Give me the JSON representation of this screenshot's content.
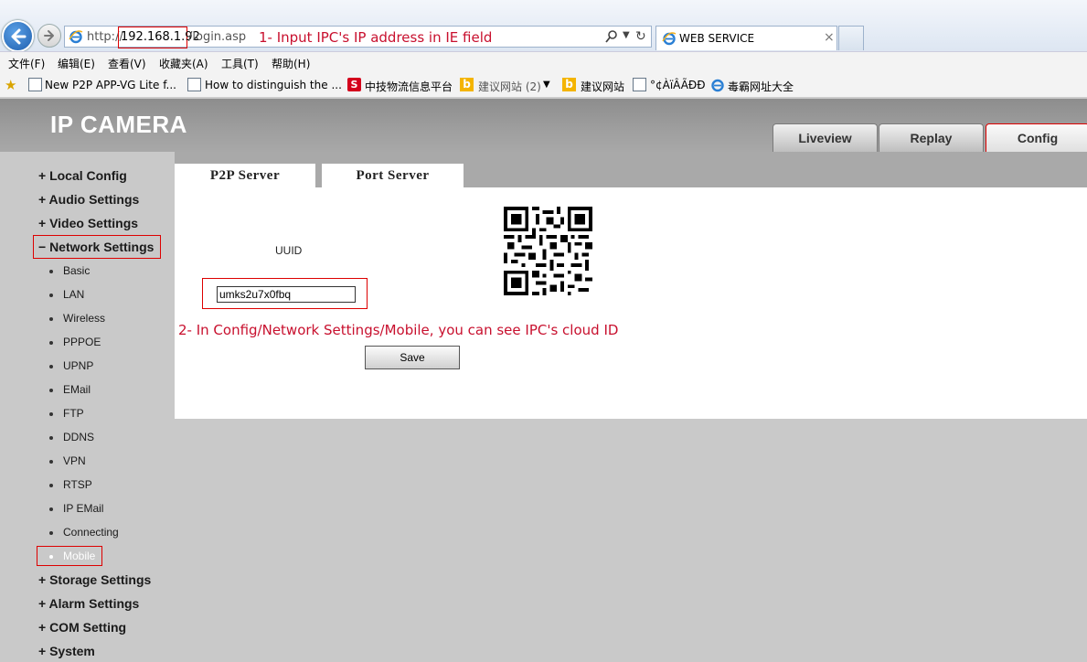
{
  "browser": {
    "address_prefix": "http://",
    "address_ip": "192.168.1.92",
    "address_path": "/login.asp",
    "tab_title": "WEB SERVICE",
    "tab_close": "×",
    "menu": [
      "文件(F)",
      "编辑(E)",
      "查看(V)",
      "收藏夹(A)",
      "工具(T)",
      "帮助(H)"
    ],
    "favorites": [
      {
        "label": "New P2P APP-VG Lite f...",
        "icon": "page-icon"
      },
      {
        "label": "How to distinguish the ...",
        "icon": "page-icon"
      },
      {
        "label": "中技物流信息平台",
        "icon": "s-logo-icon"
      },
      {
        "label": "建议网站 (2)",
        "icon": "bing-icon"
      },
      {
        "label": "建议网站",
        "icon": "bing-icon"
      },
      {
        "label": "°¢ÀïÂÃÐÐ",
        "icon": "page-icon"
      },
      {
        "label": "毒霸网址大全",
        "icon": "ie-icon"
      }
    ]
  },
  "annotations": {
    "step1": "1- Input IPC's IP address in IE field",
    "step2": "2- In Config/Network Settings/Mobile, you can see IPC's cloud ID"
  },
  "camera": {
    "title": "IP CAMERA",
    "nav": {
      "liveview": "Liveview",
      "replay": "Replay",
      "config": "Config"
    }
  },
  "sidebar": {
    "groups": {
      "local": "+ Local Config",
      "audio": "+ Audio Settings",
      "video": "+ Video Settings",
      "network": "− Network Settings",
      "storage": "+ Storage Settings",
      "alarm": "+ Alarm Settings",
      "com": "+ COM Setting",
      "system": "+ System"
    },
    "network_items": [
      "Basic",
      "LAN",
      "Wireless",
      "PPPOE",
      "UPNP",
      "EMail",
      "FTP",
      "DDNS",
      "VPN",
      "RTSP",
      "IP EMail",
      "Connecting",
      "Mobile"
    ]
  },
  "content": {
    "tabs": {
      "p2p": "P2P Server",
      "port": "Port Server"
    },
    "uuid_label": "UUID",
    "uuid_value": "umks2u7x0fbq",
    "save_label": "Save"
  },
  "colors": {
    "annotation": "#c8102e",
    "highlight_box": "#dd0000",
    "header_gray": "#9f9f9f",
    "sidebar_bg": "#c9c9c9"
  }
}
